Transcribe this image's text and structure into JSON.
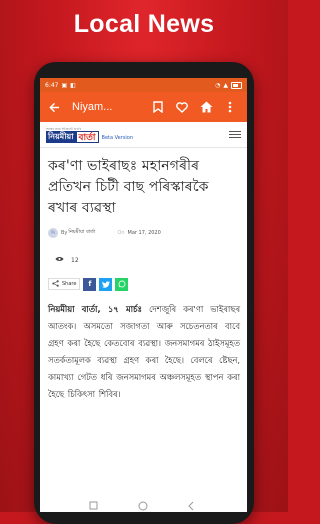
{
  "promo": {
    "title": "Local News"
  },
  "status": {
    "time": "6:47"
  },
  "appbar": {
    "title": "Niyam..."
  },
  "site": {
    "logo_left": "নিয়মীয়া",
    "logo_right": "বার্তা",
    "tagline": "অসমৰ প্ৰথম ইন্টাৰনেট বাতৰি",
    "beta": "Beta Version"
  },
  "article": {
    "headline": "কৰ'ণা ভাইৰাছঃ মহানগৰীৰ প্ৰতিখন চিটী বাছ পৰিস্কাৰকৈ ৰখাৰ ব্যৱস্থা",
    "by": "By",
    "author": "নিয়মীয়া বাৰ্তা",
    "on": "On",
    "date": "Mar 17, 2020",
    "views": "12",
    "share_label": "Share",
    "lead": "নিয়মীয়া বাৰ্তা, ১৭ মাৰ্চঃ",
    "body": "দেশজুৰি কৰ'ণা ভাইৰাছৰ আতংক। অসমতো সজাগতা আৰু সচেতনতাৰ বাবে গ্ৰহণ কৰা হৈছে কেতবোৰ ব্যৱস্থা। জনসমাগমৰ ঠাইসমূহত সতৰ্কতামূলক ব্যৱস্থা গ্ৰহণ কৰা হৈছে। বেলৰে ষ্টেছন, কামাখ্যা গেটত ধৰি জনসমাগমৰ অঞ্চলসমূহত স্থাপন কৰা হৈছে চিকিৎসা শিবিৰ।"
  }
}
